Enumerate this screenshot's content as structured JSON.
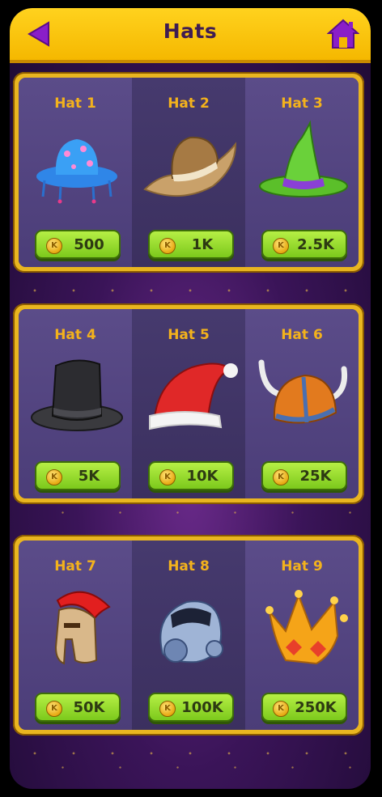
{
  "header": {
    "title": "Hats"
  },
  "coin_symbol": "K",
  "rows": [
    {
      "items": [
        {
          "name": "Hat 1",
          "price": "500",
          "icon": "blue-floral-bucket-hat-icon"
        },
        {
          "name": "Hat 2",
          "price": "1K",
          "icon": "cowboy-hat-icon"
        },
        {
          "name": "Hat 3",
          "price": "2.5K",
          "icon": "witch-hat-icon"
        }
      ]
    },
    {
      "items": [
        {
          "name": "Hat 4",
          "price": "5K",
          "icon": "top-hat-icon"
        },
        {
          "name": "Hat 5",
          "price": "10K",
          "icon": "santa-hat-icon"
        },
        {
          "name": "Hat 6",
          "price": "25K",
          "icon": "viking-helmet-icon"
        }
      ]
    },
    {
      "items": [
        {
          "name": "Hat 7",
          "price": "50K",
          "icon": "spartan-helmet-icon"
        },
        {
          "name": "Hat 8",
          "price": "100K",
          "icon": "astronaut-helmet-icon"
        },
        {
          "name": "Hat 9",
          "price": "250K",
          "icon": "crown-icon"
        }
      ]
    }
  ],
  "colors": {
    "header": "#f5b800",
    "price_button": "#8fd927",
    "title_text": "#3f1d52",
    "hat_label": "#f3b21c"
  }
}
